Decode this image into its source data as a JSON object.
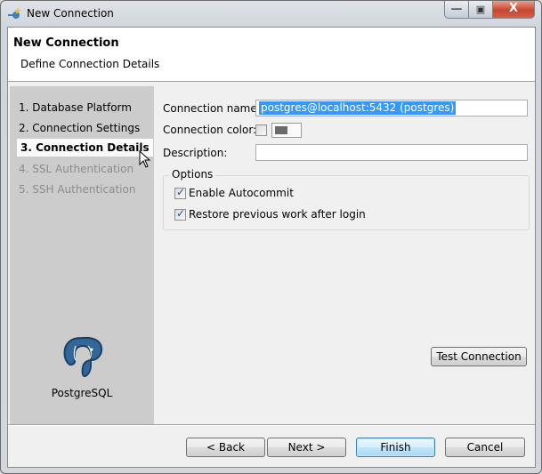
{
  "window": {
    "title": "New Connection",
    "controls": {
      "minimize": "—",
      "maximize": "▣",
      "close": "X"
    }
  },
  "header": {
    "title": "New Connection",
    "subtitle": "Define Connection Details"
  },
  "sidebar": {
    "steps": [
      {
        "label": "1. Database Platform",
        "state": "done"
      },
      {
        "label": "2. Connection Settings",
        "state": "done"
      },
      {
        "label": "3. Connection Details",
        "state": "active"
      },
      {
        "label": "4. SSL Authentication",
        "state": "disabled"
      },
      {
        "label": "5. SSH Authentication",
        "state": "disabled"
      }
    ],
    "platform_name": "PostgreSQL",
    "platform_icon": "postgresql-elephant-icon"
  },
  "form": {
    "connection_name_label": "Connection name:",
    "connection_name_value": "postgres@localhost:5432 (postgres)",
    "connection_color_label": "Connection color:",
    "connection_color_enabled": false,
    "connection_color_value": "#6a6a6a",
    "description_label": "Description:",
    "description_value": "",
    "options_label": "Options",
    "options": [
      {
        "label": "Enable Autocommit",
        "checked": true
      },
      {
        "label": "Restore previous work after login",
        "checked": true
      }
    ],
    "test_connection_label": "Test Connection"
  },
  "footer": {
    "back_label": "< Back",
    "next_label": "Next >",
    "finish_label": "Finish",
    "cancel_label": "Cancel"
  }
}
